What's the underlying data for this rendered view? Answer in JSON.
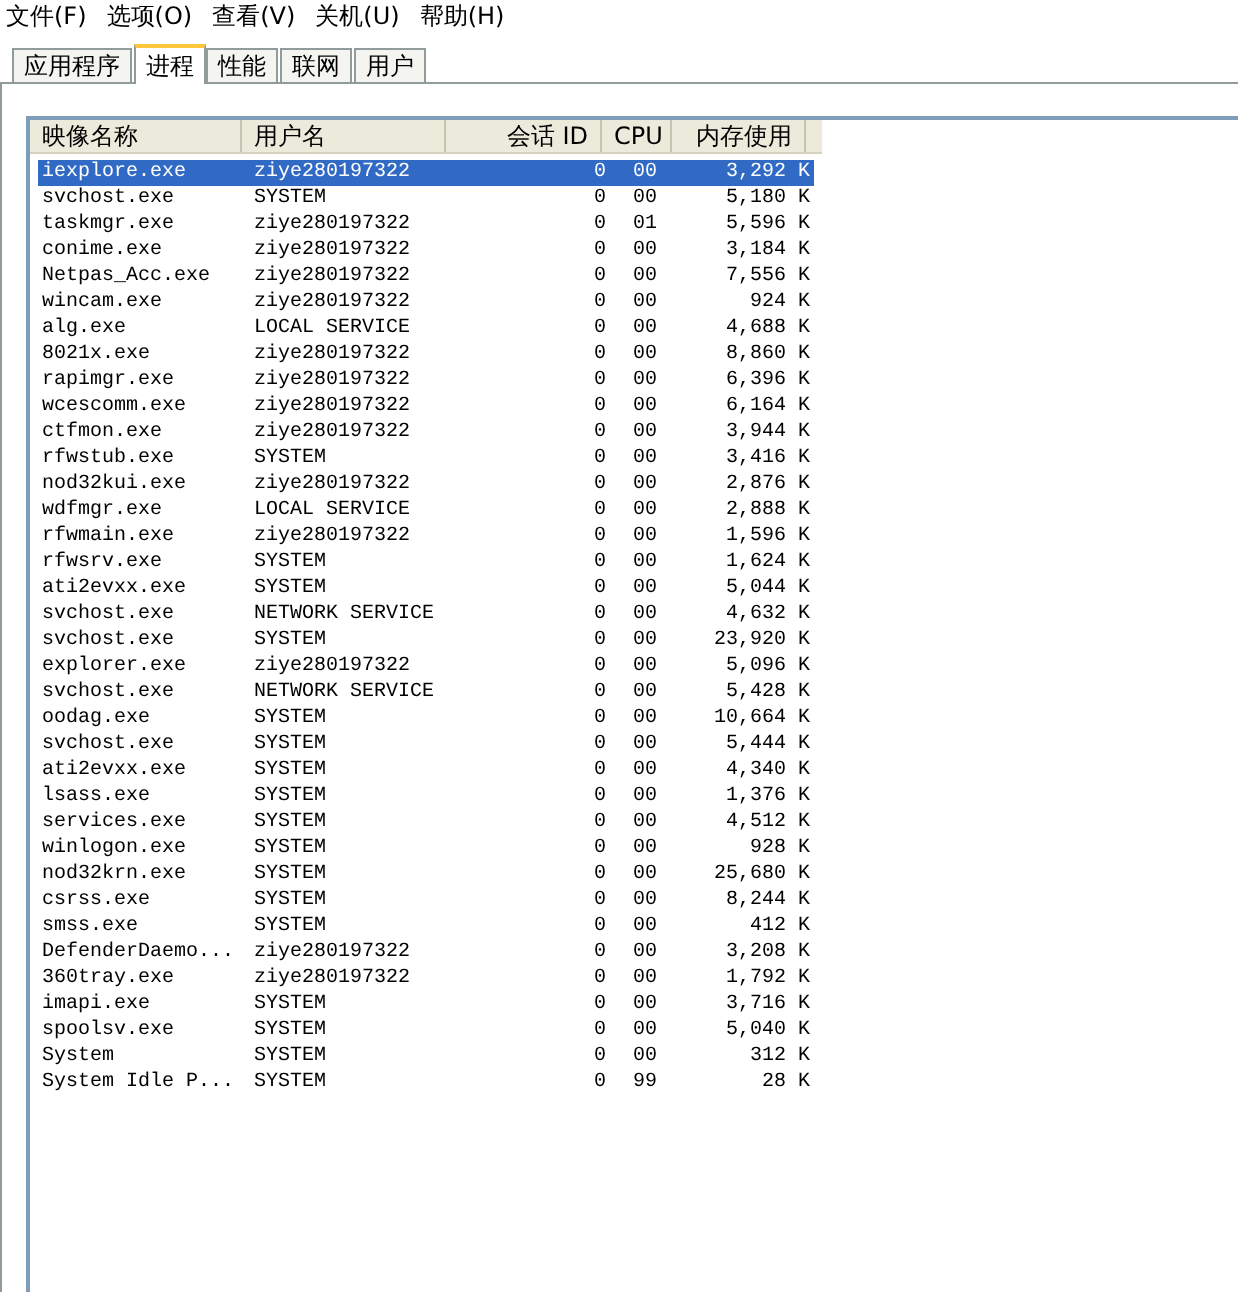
{
  "menu": [
    "文件(F)",
    "选项(O)",
    "查看(V)",
    "关机(U)",
    "帮助(H)"
  ],
  "tabs": [
    {
      "label": "应用程序",
      "selected": false
    },
    {
      "label": "进程",
      "selected": true
    },
    {
      "label": "性能",
      "selected": false
    },
    {
      "label": "联网",
      "selected": false
    },
    {
      "label": "用户",
      "selected": false
    }
  ],
  "table": {
    "columns": [
      "映像名称",
      "用户名",
      "会话 ID",
      "CPU",
      "内存使用"
    ],
    "rows": [
      {
        "name": "iexplore.exe",
        "user": "ziye280197322",
        "session": "0",
        "cpu": "00",
        "memory": "3,292 K",
        "selected": true
      },
      {
        "name": "svchost.exe",
        "user": "SYSTEM",
        "session": "0",
        "cpu": "00",
        "memory": "5,180 K",
        "selected": false
      },
      {
        "name": "taskmgr.exe",
        "user": "ziye280197322",
        "session": "0",
        "cpu": "01",
        "memory": "5,596 K",
        "selected": false
      },
      {
        "name": "conime.exe",
        "user": "ziye280197322",
        "session": "0",
        "cpu": "00",
        "memory": "3,184 K",
        "selected": false
      },
      {
        "name": "Netpas_Acc.exe",
        "user": "ziye280197322",
        "session": "0",
        "cpu": "00",
        "memory": "7,556 K",
        "selected": false
      },
      {
        "name": "wincam.exe",
        "user": "ziye280197322",
        "session": "0",
        "cpu": "00",
        "memory": "924 K",
        "selected": false
      },
      {
        "name": "alg.exe",
        "user": "LOCAL SERVICE",
        "session": "0",
        "cpu": "00",
        "memory": "4,688 K",
        "selected": false
      },
      {
        "name": "8021x.exe",
        "user": "ziye280197322",
        "session": "0",
        "cpu": "00",
        "memory": "8,860 K",
        "selected": false
      },
      {
        "name": "rapimgr.exe",
        "user": "ziye280197322",
        "session": "0",
        "cpu": "00",
        "memory": "6,396 K",
        "selected": false
      },
      {
        "name": "wcescomm.exe",
        "user": "ziye280197322",
        "session": "0",
        "cpu": "00",
        "memory": "6,164 K",
        "selected": false
      },
      {
        "name": "ctfmon.exe",
        "user": "ziye280197322",
        "session": "0",
        "cpu": "00",
        "memory": "3,944 K",
        "selected": false
      },
      {
        "name": "rfwstub.exe",
        "user": "SYSTEM",
        "session": "0",
        "cpu": "00",
        "memory": "3,416 K",
        "selected": false
      },
      {
        "name": "nod32kui.exe",
        "user": "ziye280197322",
        "session": "0",
        "cpu": "00",
        "memory": "2,876 K",
        "selected": false
      },
      {
        "name": "wdfmgr.exe",
        "user": "LOCAL SERVICE",
        "session": "0",
        "cpu": "00",
        "memory": "2,888 K",
        "selected": false
      },
      {
        "name": "rfwmain.exe",
        "user": "ziye280197322",
        "session": "0",
        "cpu": "00",
        "memory": "1,596 K",
        "selected": false
      },
      {
        "name": "rfwsrv.exe",
        "user": "SYSTEM",
        "session": "0",
        "cpu": "00",
        "memory": "1,624 K",
        "selected": false
      },
      {
        "name": "ati2evxx.exe",
        "user": "SYSTEM",
        "session": "0",
        "cpu": "00",
        "memory": "5,044 K",
        "selected": false
      },
      {
        "name": "svchost.exe",
        "user": "NETWORK SERVICE",
        "session": "0",
        "cpu": "00",
        "memory": "4,632 K",
        "selected": false
      },
      {
        "name": "svchost.exe",
        "user": "SYSTEM",
        "session": "0",
        "cpu": "00",
        "memory": "23,920 K",
        "selected": false
      },
      {
        "name": "explorer.exe",
        "user": "ziye280197322",
        "session": "0",
        "cpu": "00",
        "memory": "5,096 K",
        "selected": false
      },
      {
        "name": "svchost.exe",
        "user": "NETWORK SERVICE",
        "session": "0",
        "cpu": "00",
        "memory": "5,428 K",
        "selected": false
      },
      {
        "name": "oodag.exe",
        "user": "SYSTEM",
        "session": "0",
        "cpu": "00",
        "memory": "10,664 K",
        "selected": false
      },
      {
        "name": "svchost.exe",
        "user": "SYSTEM",
        "session": "0",
        "cpu": "00",
        "memory": "5,444 K",
        "selected": false
      },
      {
        "name": "ati2evxx.exe",
        "user": "SYSTEM",
        "session": "0",
        "cpu": "00",
        "memory": "4,340 K",
        "selected": false
      },
      {
        "name": "lsass.exe",
        "user": "SYSTEM",
        "session": "0",
        "cpu": "00",
        "memory": "1,376 K",
        "selected": false
      },
      {
        "name": "services.exe",
        "user": "SYSTEM",
        "session": "0",
        "cpu": "00",
        "memory": "4,512 K",
        "selected": false
      },
      {
        "name": "winlogon.exe",
        "user": "SYSTEM",
        "session": "0",
        "cpu": "00",
        "memory": "928 K",
        "selected": false
      },
      {
        "name": "nod32krn.exe",
        "user": "SYSTEM",
        "session": "0",
        "cpu": "00",
        "memory": "25,680 K",
        "selected": false
      },
      {
        "name": "csrss.exe",
        "user": "SYSTEM",
        "session": "0",
        "cpu": "00",
        "memory": "8,244 K",
        "selected": false
      },
      {
        "name": "smss.exe",
        "user": "SYSTEM",
        "session": "0",
        "cpu": "00",
        "memory": "412 K",
        "selected": false
      },
      {
        "name": "DefenderDaemo...",
        "user": "ziye280197322",
        "session": "0",
        "cpu": "00",
        "memory": "3,208 K",
        "selected": false
      },
      {
        "name": "360tray.exe",
        "user": "ziye280197322",
        "session": "0",
        "cpu": "00",
        "memory": "1,792 K",
        "selected": false
      },
      {
        "name": "imapi.exe",
        "user": "SYSTEM",
        "session": "0",
        "cpu": "00",
        "memory": "3,716 K",
        "selected": false
      },
      {
        "name": "spoolsv.exe",
        "user": "SYSTEM",
        "session": "0",
        "cpu": "00",
        "memory": "5,040 K",
        "selected": false
      },
      {
        "name": "System",
        "user": "SYSTEM",
        "session": "0",
        "cpu": "00",
        "memory": "312 K",
        "selected": false
      },
      {
        "name": "System Idle P...",
        "user": "SYSTEM",
        "session": "0",
        "cpu": "99",
        "memory": "28 K",
        "selected": false
      }
    ]
  }
}
